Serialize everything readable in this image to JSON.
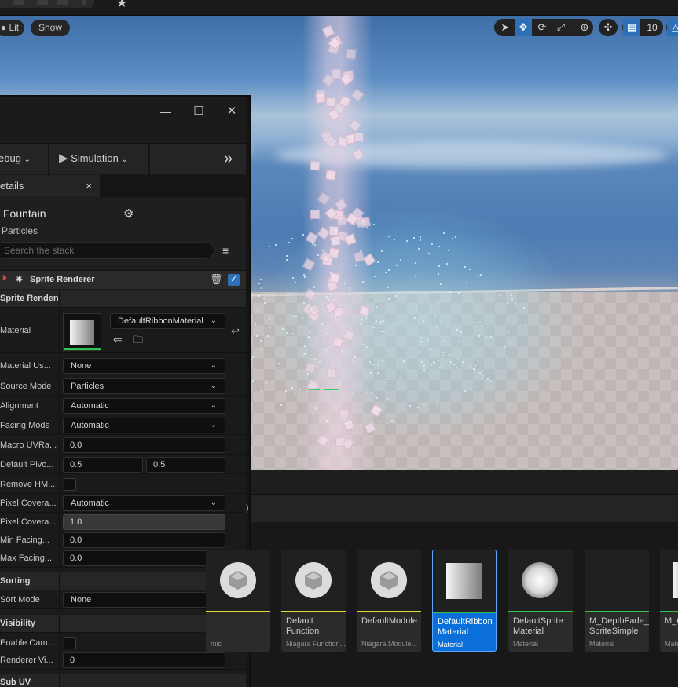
{
  "viewport": {
    "view_mode": "Lit",
    "show_label": "Show",
    "grid_snap_value": "10"
  },
  "window": {
    "minimize_glyph": "—",
    "maximize_glyph": "☐",
    "close_glyph": "✕"
  },
  "toolbar": {
    "debug_label": "ebug",
    "simulation_label": "Simulation"
  },
  "details_tab": {
    "label": "etails",
    "close_glyph": "×"
  },
  "details": {
    "title": "Fountain",
    "subtitle": "Particles",
    "search_placeholder": "Search the stack"
  },
  "sprite_renderer": {
    "header": "Sprite Renderer",
    "category_label": "Sprite Rendeni",
    "rows": {
      "material_label": "Material",
      "material_value": "DefaultRibbonMaterial",
      "material_user_label": "Material Us...",
      "material_user_value": "None",
      "source_mode_label": "Source Mode",
      "source_mode_value": "Particles",
      "alignment_label": "Alignment",
      "alignment_value": "Automatic",
      "facing_mode_label": "Facing Mode",
      "facing_mode_value": "Automatic",
      "macro_uv_label": "Macro UVRa...",
      "macro_uv_value": "0.0",
      "default_pivot_label": "Default Pivo...",
      "default_pivot_x": "0.5",
      "default_pivot_y": "0.5",
      "remove_hmd_label": "Remove HM...",
      "pixel_coverage_mode_label": "Pixel Covera...",
      "pixel_coverage_mode_value": "Automatic",
      "pixel_coverage_blend_label": "Pixel Covera...",
      "pixel_coverage_blend_value": "1.0",
      "min_facing_label": "Min Facing...",
      "min_facing_value": "0.0",
      "max_facing_label": "Max Facing...",
      "max_facing_value": "0.0"
    }
  },
  "sorting": {
    "category_label": "Sorting",
    "sort_mode_label": "Sort Mode",
    "sort_mode_value": "None"
  },
  "visibility": {
    "category_label": "Visibility",
    "enable_camera_label": "Enable Cam...",
    "renderer_vis_label": "Renderer Vi...",
    "renderer_vis_value": "0"
  },
  "sub_uv": {
    "category_label": "Sub UV"
  },
  "content_browser": {
    "tiles": [
      {
        "name": "",
        "type": "mic",
        "bar_color": "#e0d832"
      },
      {
        "name": "Default Function",
        "type": "Niagara Function...",
        "bar_color": "#e0d832"
      },
      {
        "name": "DefaultModule",
        "type": "Niagara Module...",
        "bar_color": "#e0d832"
      },
      {
        "name": "DefaultRibbon Material",
        "type": "Material",
        "bar_color": "#2ec24f"
      },
      {
        "name": "DefaultSprite Material",
        "type": "Material",
        "bar_color": "#2ec24f"
      },
      {
        "name": "M_DepthFade_ SpriteSimple",
        "type": "Material",
        "bar_color": "#2ec24f"
      },
      {
        "name": "M_G",
        "type": "Mate",
        "bar_color": "#2ec24f"
      }
    ]
  }
}
